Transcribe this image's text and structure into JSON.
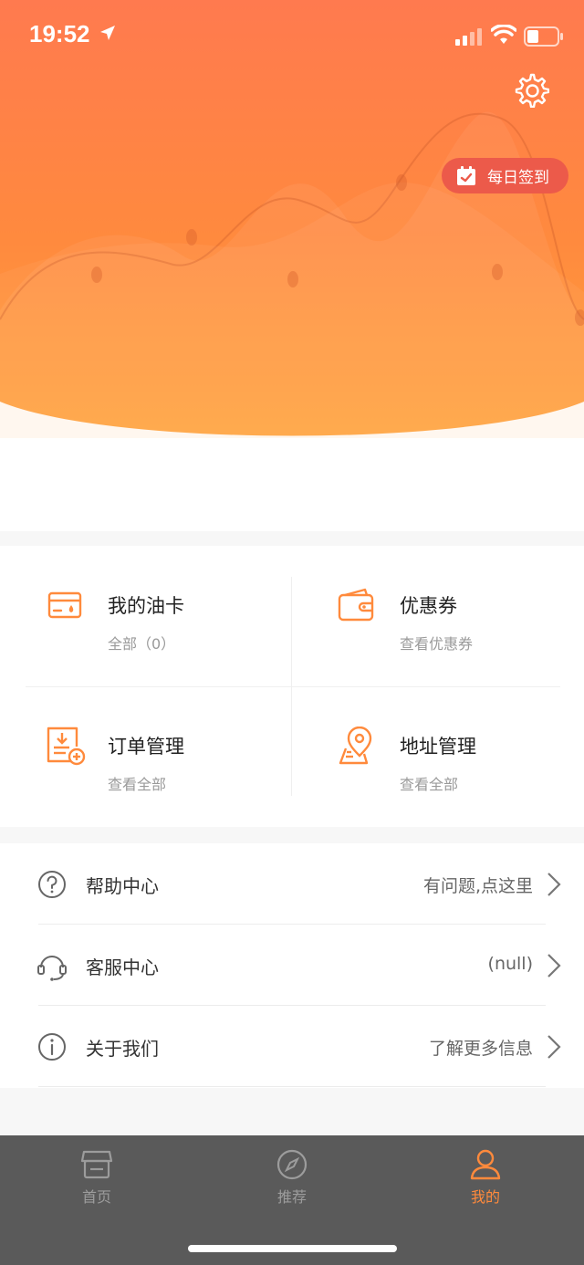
{
  "status_bar": {
    "time": "19:52"
  },
  "header": {
    "checkin_label": "每日签到"
  },
  "grid": [
    {
      "title": "我的油卡",
      "subtitle": "全部（0）",
      "icon": "fuel-card-icon"
    },
    {
      "title": "优惠券",
      "subtitle": "查看优惠券",
      "icon": "wallet-icon"
    },
    {
      "title": "订单管理",
      "subtitle": "查看全部",
      "icon": "order-icon"
    },
    {
      "title": "地址管理",
      "subtitle": "查看全部",
      "icon": "location-icon"
    }
  ],
  "list": [
    {
      "label": "帮助中心",
      "hint": "有问题,点这里",
      "icon": "help-icon"
    },
    {
      "label": "客服中心",
      "hint": "(null)",
      "icon": "headset-icon"
    },
    {
      "label": "关于我们",
      "hint": "了解更多信息",
      "icon": "info-icon"
    }
  ],
  "tabs": [
    {
      "label": "首页",
      "icon": "store-icon",
      "active": false
    },
    {
      "label": "推荐",
      "icon": "compass-icon",
      "active": false
    },
    {
      "label": "我的",
      "icon": "user-icon",
      "active": true
    }
  ],
  "colors": {
    "accent": "#ff8a3c",
    "checkin_bg": "#ec5a4a",
    "tab_bar": "#5a5a5a"
  }
}
